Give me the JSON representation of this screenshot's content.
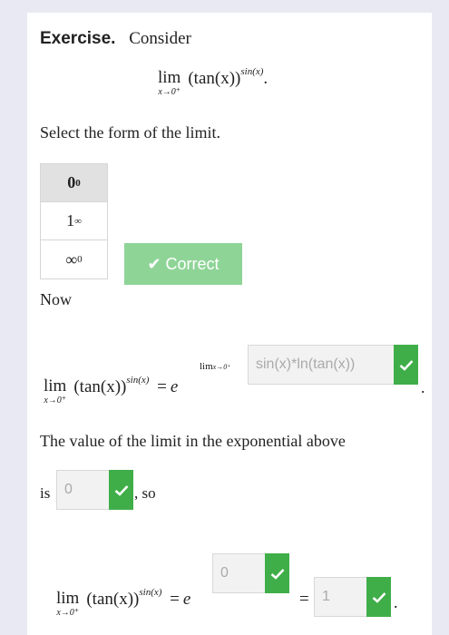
{
  "exercise": {
    "heading": "Exercise.",
    "intro": "Consider",
    "expression": {
      "lim_word": "lim",
      "lim_sub": "x→0⁺",
      "base": "(tan(x))",
      "power": "sin(x)",
      "period": "."
    }
  },
  "question": {
    "prompt": "Select the form of the limit.",
    "choices": [
      {
        "base": "0",
        "exp": "0",
        "selected": true
      },
      {
        "base": "1",
        "exp": "∞",
        "selected": false
      },
      {
        "base": "∞",
        "exp": "0",
        "selected": false
      }
    ],
    "feedback": "✔ Correct",
    "feedback_color": "#8fd497"
  },
  "now": {
    "label": "Now",
    "lhs": {
      "lim_word": "lim",
      "lim_sub": "x→0⁺",
      "base": "(tan(x))",
      "power": "sin(x)"
    },
    "equals": "=",
    "e": "e",
    "exp_lim_word": "lim",
    "exp_lim_sub": "x→0⁺",
    "answer1_value": "sin(x)*ln(tan(x))",
    "trailing_period": "."
  },
  "value": {
    "line": "The value of the limit in the exponential above",
    "is_label": "is",
    "answer2_value": "0",
    "so_label": ", so"
  },
  "final": {
    "lhs": {
      "lim_word": "lim",
      "lim_sub": "x→0⁺",
      "base": "(tan(x))",
      "power": "sin(x)"
    },
    "equals": "=",
    "e": "e",
    "answer3_value": "0",
    "equals2": "=",
    "answer4_value": "1",
    "trailing_period": "."
  },
  "colors": {
    "check_green": "#3fae49",
    "answer_bg": "#f2f2f2"
  }
}
